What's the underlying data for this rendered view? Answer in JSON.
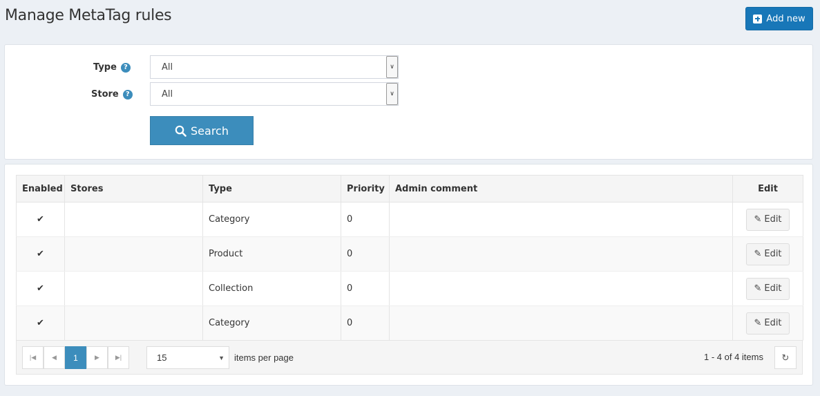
{
  "header": {
    "title": "Manage MetaTag rules",
    "add_new_label": "Add new"
  },
  "search": {
    "type_label": "Type",
    "type_value": "All",
    "store_label": "Store",
    "store_value": "All",
    "search_label": "Search",
    "help_glyph": "?"
  },
  "grid": {
    "columns": [
      "Enabled",
      "Stores",
      "Type",
      "Priority",
      "Admin comment",
      "Edit"
    ],
    "rows": [
      {
        "enabled": "✔",
        "stores": "",
        "type": "Category",
        "priority": "0",
        "comment": "",
        "edit": "Edit"
      },
      {
        "enabled": "✔",
        "stores": "",
        "type": "Product",
        "priority": "0",
        "comment": "",
        "edit": "Edit"
      },
      {
        "enabled": "✔",
        "stores": "",
        "type": "Collection",
        "priority": "0",
        "comment": "",
        "edit": "Edit"
      },
      {
        "enabled": "✔",
        "stores": "",
        "type": "Category",
        "priority": "0",
        "comment": "",
        "edit": "Edit"
      }
    ]
  },
  "pager": {
    "current_page": "1",
    "page_size": "15",
    "items_per_page_label": "items per page",
    "info": "1 - 4 of 4 items"
  },
  "colors": {
    "primary": "#3c8dbc",
    "add_button": "#1877b8",
    "check": "#1877b8"
  }
}
